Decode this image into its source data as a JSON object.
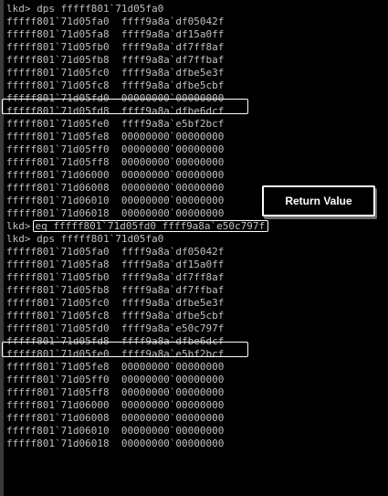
{
  "window": {
    "bg": "#000000",
    "text_color": "#c0c0c0",
    "highlight_color": "#ffffff"
  },
  "callout": {
    "label": "Return Value"
  },
  "block1": {
    "prompt": "lkd>",
    "command": "dps fffff801`71d05fa0",
    "rows": [
      "fffff801`71d05fa0  ffff9a8a`df05042f",
      "fffff801`71d05fa8  ffff9a8a`df15a0ff",
      "fffff801`71d05fb0  ffff9a8a`df7ff8af",
      "fffff801`71d05fb8  ffff9a8a`df7ffbaf",
      "fffff801`71d05fc0  ffff9a8a`dfbe5e3f",
      "fffff801`71d05fc8  ffff9a8a`dfbe5cbf",
      "fffff801`71d05fd0  00000000`00000000",
      "fffff801`71d05fd8  ffff9a8a`dfbe6dcf",
      "fffff801`71d05fe0  ffff9a8a`e5bf2bcf",
      "fffff801`71d05fe8  00000000`00000000",
      "fffff801`71d05ff0  00000000`00000000",
      "fffff801`71d05ff8  00000000`00000000",
      "fffff801`71d06000  00000000`00000000",
      "fffff801`71d06008  00000000`00000000",
      "fffff801`71d06010  00000000`00000000",
      "fffff801`71d06018  00000000`00000000"
    ]
  },
  "eq_line": {
    "prompt": "lkd>",
    "command": "eq fffff801`71d05fd0 ffff9a8a`e50c797f"
  },
  "block2": {
    "prompt": "lkd>",
    "command": "dps fffff801`71d05fa0",
    "rows": [
      "fffff801`71d05fa0  ffff9a8a`df05042f",
      "fffff801`71d05fa8  ffff9a8a`df15a0ff",
      "fffff801`71d05fb0  ffff9a8a`df7ff8af",
      "fffff801`71d05fb8  ffff9a8a`df7ffbaf",
      "fffff801`71d05fc0  ffff9a8a`dfbe5e3f",
      "fffff801`71d05fc8  ffff9a8a`dfbe5cbf",
      "fffff801`71d05fd0  ffff9a8a`e50c797f",
      "fffff801`71d05fd8  ffff9a8a`dfbe6dcf",
      "fffff801`71d05fe0  ffff9a8a`e5bf2bcf",
      "fffff801`71d05fe8  00000000`00000000",
      "fffff801`71d05ff0  00000000`00000000",
      "fffff801`71d05ff8  00000000`00000000",
      "fffff801`71d06000  00000000`00000000",
      "fffff801`71d06008  00000000`00000000",
      "fffff801`71d06010  00000000`00000000",
      "fffff801`71d06018  00000000`00000000"
    ]
  }
}
